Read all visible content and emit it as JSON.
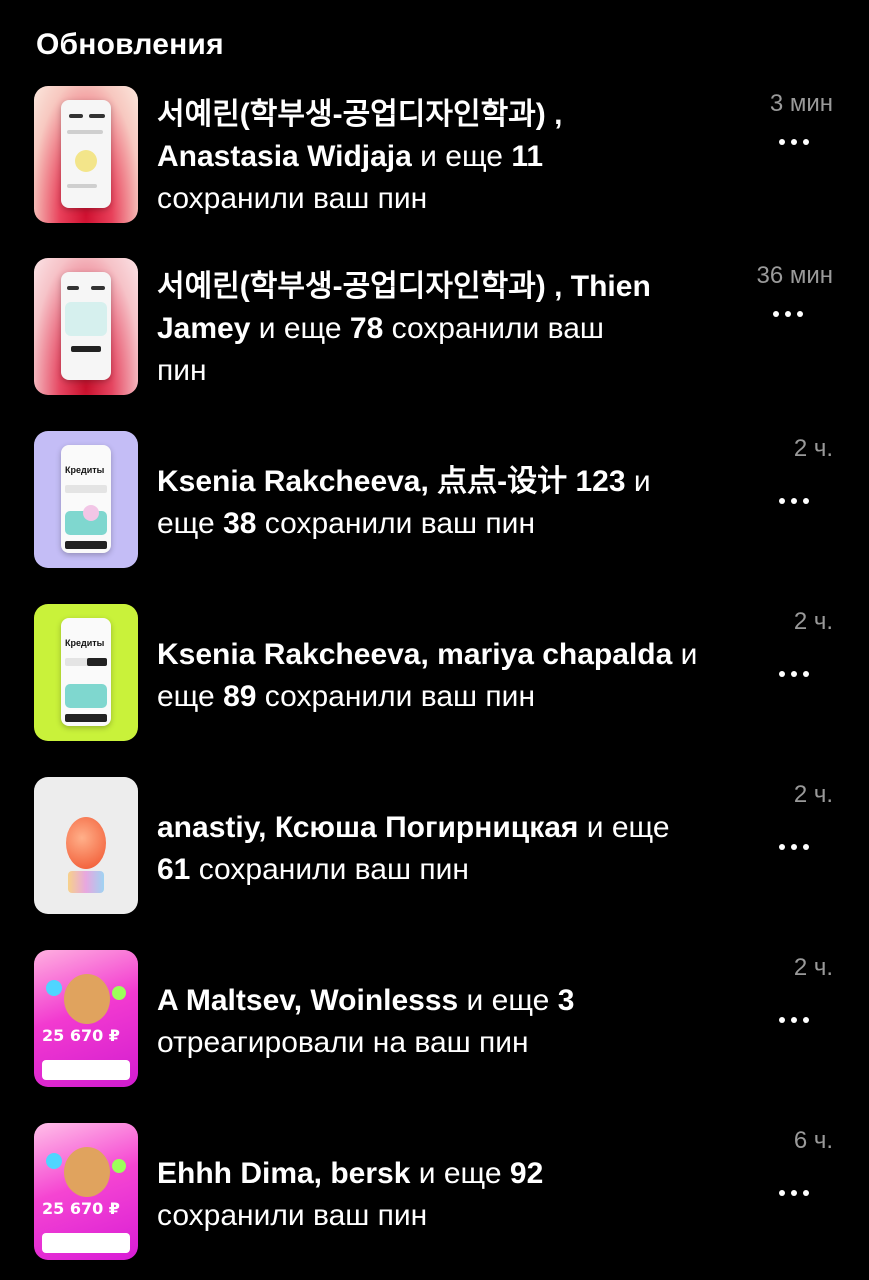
{
  "header": {
    "title": "Обновления"
  },
  "items": [
    {
      "lines": [
        "서예린(학부생-공업디자인학과) ,",
        "Anastasia Widjaja",
        " и еще ",
        "11",
        "сохранили ваш пин"
      ],
      "time": "3 мин",
      "thumb": "app-mockup-thumbnail-pink"
    },
    {
      "lines": [
        "서예린(학부생-공업디자인학과) , Thien",
        "Jamey",
        " и еще ",
        "78",
        " сохранили ваш",
        "пин"
      ],
      "time": "36 мин",
      "thumb": "app-mockup-thumbnail-pink-chart"
    },
    {
      "lines": [
        "Ksenia Rakcheeva, 点点-设计 123",
        " и",
        "еще ",
        "38",
        " сохранили ваш пин"
      ],
      "time": "2 ч.",
      "thumb": "credits-app-thumbnail-lavender",
      "thumb_text": "Кредиты"
    },
    {
      "lines": [
        "Ksenia Rakcheeva, mariya chapalda",
        " и",
        "еще ",
        "89",
        " сохранили ваш пин"
      ],
      "time": "2 ч.",
      "thumb": "credits-app-thumbnail-lime",
      "thumb_text": "Кредиты"
    },
    {
      "lines": [
        "anastiy, Ксюша Погирницкая",
        " и еще",
        "61",
        " сохранили ваш пин"
      ],
      "time": "2 ч.",
      "thumb": "orange-blob-card-thumbnail"
    },
    {
      "lines": [
        "A Maltsev, Woinlesss",
        " и еще ",
        "3",
        "отреагировали на ваш пин"
      ],
      "time": "2 ч.",
      "thumb": "magenta-promo-thumbnail",
      "thumb_text": "25 670 ₽"
    },
    {
      "lines": [
        "Ehhh Dima, bersk",
        " и еще ",
        "92",
        "сохранили ваш пин"
      ],
      "time": "6 ч.",
      "thumb": "magenta-promo-thumbnail-2",
      "thumb_text": "25 670 ₽"
    }
  ]
}
